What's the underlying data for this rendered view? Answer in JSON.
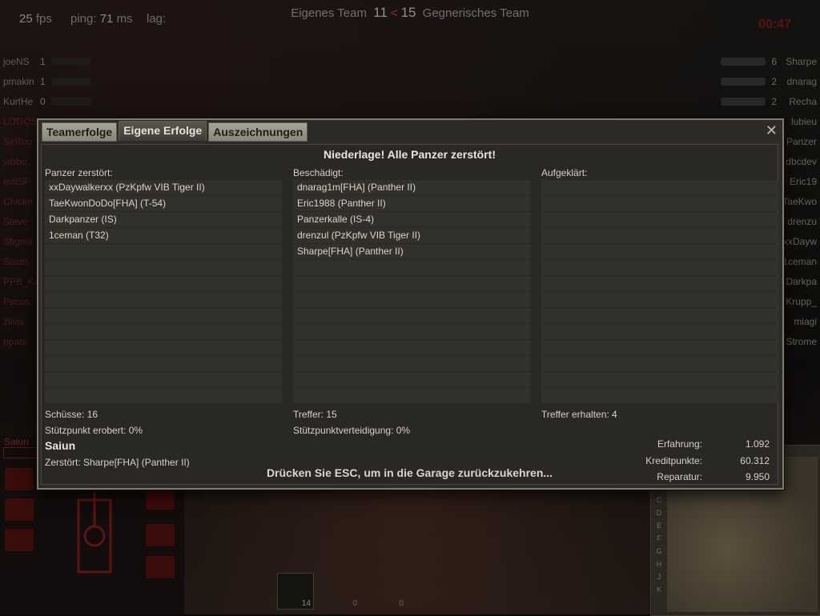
{
  "hud": {
    "fps_value": "25",
    "fps_unit": "fps",
    "ping_label": "ping:",
    "ping_value": "71",
    "ping_unit": "ms",
    "lag_label": "lag:",
    "own_team_label": "Eigenes Team",
    "own_score": "11",
    "separator": "<",
    "enemy_score": "15",
    "enemy_team_label": "Gegnerisches Team",
    "timer": "00:47"
  },
  "teams": {
    "left": [
      {
        "name": "joeNS",
        "count": "1"
      },
      {
        "name": "pmakin",
        "count": "1"
      },
      {
        "name": "KurtHe",
        "count": "0"
      },
      {
        "name": "LOGOSi",
        "count": ""
      },
      {
        "name": "SirRou",
        "count": ""
      },
      {
        "name": "jabbo",
        "count": ""
      },
      {
        "name": "evilSF",
        "count": ""
      },
      {
        "name": "Chicke",
        "count": ""
      },
      {
        "name": "Steve",
        "count": ""
      },
      {
        "name": "Stigma",
        "count": ""
      },
      {
        "name": "Saiun",
        "count": ""
      },
      {
        "name": "PPB_Ko",
        "count": ""
      },
      {
        "name": "Pacos",
        "count": ""
      },
      {
        "name": "zilvis",
        "count": ""
      },
      {
        "name": "ppats",
        "count": ""
      }
    ],
    "right": [
      {
        "name": "Sharpe",
        "count": "6"
      },
      {
        "name": "dnarag",
        "count": "2"
      },
      {
        "name": "Recha",
        "count": "2"
      },
      {
        "name": "lubieu",
        "count": ""
      },
      {
        "name": "Panzer",
        "count": ""
      },
      {
        "name": "dbcdev",
        "count": ""
      },
      {
        "name": "Eric19",
        "count": ""
      },
      {
        "name": "TaeKwo",
        "count": ""
      },
      {
        "name": "drenzu",
        "count": ""
      },
      {
        "name": "xxDayw",
        "count": ""
      },
      {
        "name": "1ceman",
        "count": ""
      },
      {
        "name": "Darkpa",
        "count": ""
      },
      {
        "name": "Krupp_",
        "count": ""
      },
      {
        "name": "miagi",
        "count": ""
      },
      {
        "name": "Strome",
        "count": ""
      }
    ]
  },
  "bottom_hud": {
    "player_name": "Saiun",
    "slot_ammo_1": "14",
    "slot_ammo_2": "0",
    "slot_ammo_3": "0",
    "minimap_rows": [
      "C",
      "D",
      "E",
      "F",
      "G",
      "H",
      "J",
      "K"
    ]
  },
  "modal": {
    "tabs": [
      "Teamerfolge",
      "Eigene Erfolge",
      "Auszeichnungen"
    ],
    "active_tab": "Eigene Erfolge",
    "close_glyph": "✕",
    "result_title": "Niederlage! Alle Panzer zerstört!",
    "columns": [
      {
        "header": "Panzer zerstört:",
        "items": [
          "xxDaywalkerxx (PzKpfw VIB Tiger II)",
          "TaeKwonDoDo[FHA] (T-54)",
          "Darkpanzer (IS)",
          "1ceman (T32)"
        ]
      },
      {
        "header": "Beschädigt:",
        "items": [
          "dnarag1m[FHA] (Panther II)",
          "Eric1988 (Panther II)",
          "Panzerkalle (IS-4)",
          "drenzul (PzKpfw VIB Tiger II)",
          "Sharpe[FHA] (Panther II)"
        ]
      },
      {
        "header": "Aufgeklärt:",
        "items": []
      }
    ],
    "stats": {
      "shots": "Schüsse: 16",
      "hits": "Treffer: 15",
      "hits_received": "Treffer erhalten: 4",
      "base_captured": "Stützpunkt erobert: 0%",
      "base_defended": "Stützpunktverteidigung: 0%"
    },
    "player": "Saiun",
    "destroyed_by": "Zerstört: Sharpe[FHA] (Panther II)",
    "esc_hint": "Drücken Sie ESC, um in die Garage zurückzukehren...",
    "rewards": [
      {
        "label": "Erfahrung:",
        "value": "1.092"
      },
      {
        "label": "Kreditpunkte:",
        "value": "60.312"
      },
      {
        "label": "Reparatur:",
        "value": "9.950"
      }
    ]
  },
  "colors": {
    "accent_red": "#7a2a24",
    "panel": "#2d2b26",
    "tab_inactive": "#a7a397"
  }
}
